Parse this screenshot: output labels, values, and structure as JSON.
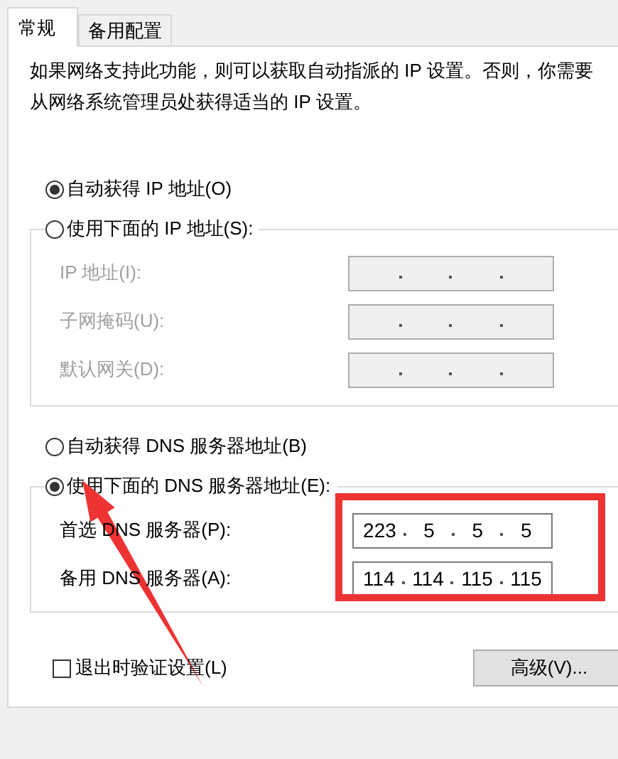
{
  "tabs": [
    {
      "label": "常规",
      "selected": true
    },
    {
      "label": "备用配置",
      "selected": false
    }
  ],
  "description": "如果网络支持此功能，则可以获取自动指派的 IP 设置。否则，你需要从网络系统管理员处获得适当的 IP 设置。",
  "ip_mode": [
    {
      "label": "自动获得 IP 地址(O)",
      "selected": true
    },
    {
      "label": "使用下面的 IP 地址(S):",
      "selected": false
    }
  ],
  "ip_fields": [
    {
      "label": "IP 地址(I):",
      "disabled": true
    },
    {
      "label": "子网掩码(U):",
      "disabled": true
    },
    {
      "label": "默认网关(D):",
      "disabled": true
    }
  ],
  "dns_mode": [
    {
      "label": "自动获得 DNS 服务器地址(B)",
      "selected": false
    },
    {
      "label": "使用下面的 DNS 服务器地址(E):",
      "selected": true
    }
  ],
  "dns_fields": [
    {
      "label": "首选 DNS 服务器(P):",
      "disabled": false,
      "octets": [
        "223",
        "5",
        "5",
        "5"
      ]
    },
    {
      "label": "备用 DNS 服务器(A):",
      "disabled": false,
      "octets": [
        "114",
        "114",
        "115",
        "115"
      ]
    }
  ],
  "validate_on_exit": {
    "label": "退出时验证设置(L)",
    "checked": false
  },
  "advanced_button": "高级(V)..."
}
